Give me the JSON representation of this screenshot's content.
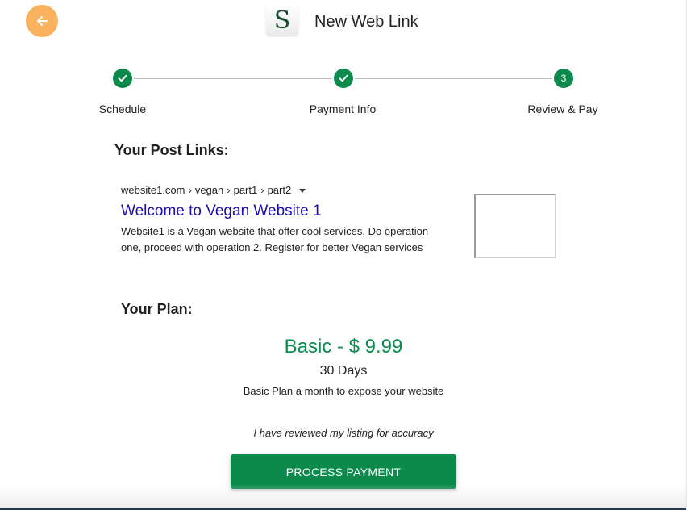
{
  "header": {
    "title": "New Web Link",
    "logo_letter": "S",
    "back_icon": "arrow-left-icon"
  },
  "stepper": {
    "steps": [
      {
        "label": "Schedule",
        "state": "done",
        "marker": ""
      },
      {
        "label": "Payment Info",
        "state": "done",
        "marker": ""
      },
      {
        "label": "Review & Pay",
        "state": "active",
        "marker": "3"
      }
    ]
  },
  "post_links": {
    "heading": "Your Post Links:",
    "breadcrumb": [
      "website1.com",
      "vegan",
      "part1",
      "part2"
    ],
    "title": "Welcome to Vegan Website 1",
    "description": "Website1 is a Vegan website that offer cool services. Do operation one, proceed with operation 2. Register for better Vegan services"
  },
  "plan": {
    "heading": "Your Plan:",
    "name": "Basic - $ 9.99",
    "duration": "30 Days",
    "description": "Basic Plan a month to expose your website"
  },
  "review_note": "I have reviewed my listing for accuracy",
  "pay_button": "PROCESS PAYMENT",
  "colors": {
    "accent_green": "#0b8a4c",
    "back_orange": "#fbb25e",
    "link_blue": "#1a0dab"
  }
}
